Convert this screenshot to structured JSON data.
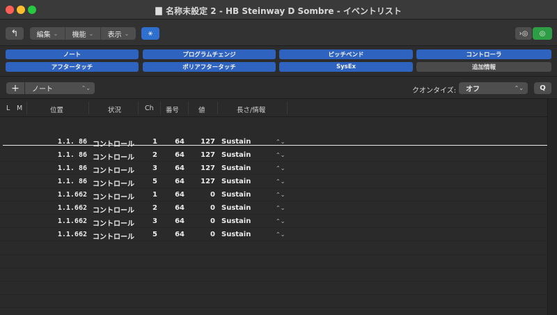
{
  "window": {
    "title": "名称未設定 2 - HB Steinway D Sombre - イベントリスト"
  },
  "toolbar": {
    "back_icon": "↰",
    "menus": [
      {
        "label": "編集"
      },
      {
        "label": "機能"
      },
      {
        "label": "表示"
      }
    ],
    "midi_in_icon": "⚹",
    "right_icon1": "›◎",
    "right_icon2": "◎"
  },
  "filters": {
    "row1": [
      "ノート",
      "プログラムチェンジ",
      "ピッチベンド",
      "コントローラ"
    ],
    "row2": [
      "アフタータッチ",
      "ポリアフタータッチ",
      "SysEx",
      "追加情報"
    ]
  },
  "controls": {
    "add_label": "+",
    "event_type": "ノート",
    "quantize_label": "クオンタイズ:",
    "quantize_value": "オフ",
    "q_label": "Q"
  },
  "columns": {
    "l": "L",
    "m": "M",
    "position": "位置",
    "status": "状況",
    "ch": "Ch",
    "number": "番号",
    "value": "値",
    "length": "長さ/情報"
  },
  "events": [
    {
      "position": "1.1. 86",
      "status": "コントロール",
      "ch": "1",
      "number": "64",
      "value": "127",
      "info": "Sustain"
    },
    {
      "position": "1.1. 86",
      "status": "コントロール",
      "ch": "2",
      "number": "64",
      "value": "127",
      "info": "Sustain"
    },
    {
      "position": "1.1. 86",
      "status": "コントロール",
      "ch": "3",
      "number": "64",
      "value": "127",
      "info": "Sustain"
    },
    {
      "position": "1.1. 86",
      "status": "コントロール",
      "ch": "5",
      "number": "64",
      "value": "127",
      "info": "Sustain"
    },
    {
      "position": "1.1.662",
      "status": "コントロール",
      "ch": "1",
      "number": "64",
      "value": "0",
      "info": "Sustain"
    },
    {
      "position": "1.1.662",
      "status": "コントロール",
      "ch": "2",
      "number": "64",
      "value": "0",
      "info": "Sustain"
    },
    {
      "position": "1.1.662",
      "status": "コントロール",
      "ch": "3",
      "number": "64",
      "value": "0",
      "info": "Sustain"
    },
    {
      "position": "1.1.662",
      "status": "コントロール",
      "ch": "5",
      "number": "64",
      "value": "0",
      "info": "Sustain"
    }
  ]
}
